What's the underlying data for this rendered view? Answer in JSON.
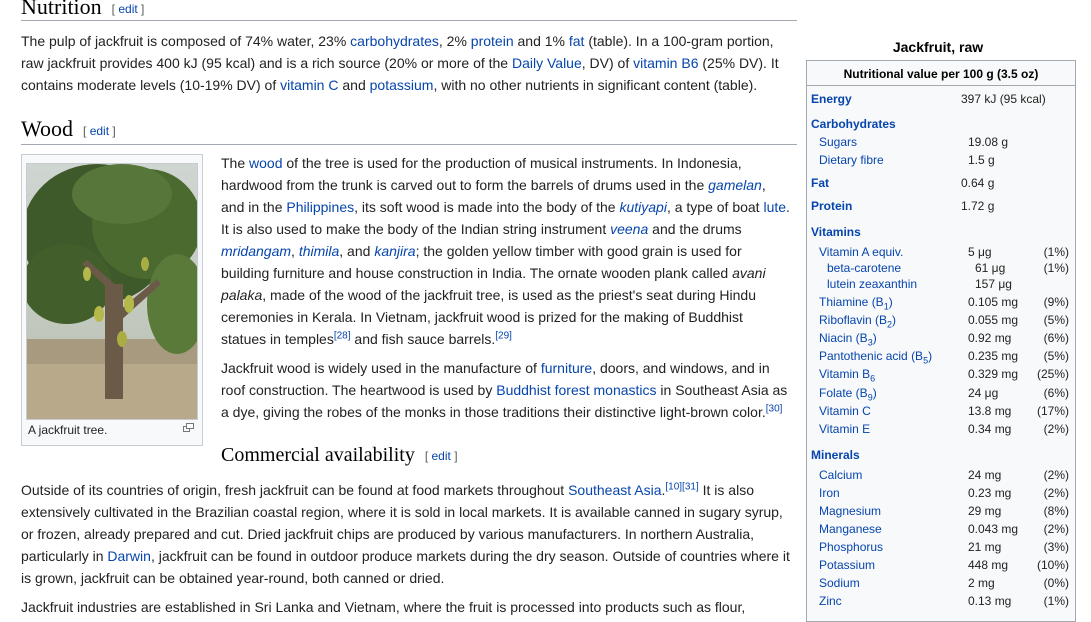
{
  "nutrition": {
    "title": "Nutrition",
    "edit": "edit",
    "text": {
      "p1": "The pulp of jackfruit is composed of 74% water, 23% ",
      "carbohydrates": "carbohydrates",
      "p2": ", 2% ",
      "protein": "protein",
      "p3": " and 1% ",
      "fat": "fat",
      "p4": " (table). In a 100-gram portion,",
      "p5": "raw jackfruit provides 400 kJ (95 kcal) and is a rich source (20% or more of the ",
      "daily_value": "Daily Value",
      "p6": ", DV) of ",
      "vitamin_b6": "vitamin B6",
      "p7": " (25% DV). It",
      "p8": "contains moderate levels (10-19% DV) of ",
      "vitamin_c": "vitamin C",
      "p9": " and ",
      "potassium": "potassium",
      "p10": ", with no other nutrients in significant content (table)."
    }
  },
  "wood": {
    "title": "Wood",
    "edit": "edit",
    "caption": "A jackfruit tree.",
    "expand_icon": "enlarge-icon",
    "lines": {
      "l1a": "The ",
      "l1_wood": "wood",
      "l1b": " of the tree is used for the production of musical instruments. In Indonesia,",
      "l2a": "hardwood from the trunk is carved out to form the barrels of drums used in the ",
      "l2_gamelan": "gamelan",
      "l2b": ",",
      "l3a": "and in the ",
      "l3_phil": "Philippines",
      "l3b": ", its soft wood is made into the body of the ",
      "l3_kutiyapi": "kutiyapi",
      "l3c": ", a type of boat ",
      "l3_lute": "lute",
      "l3d": ".",
      "l4a": "It is also used to make the body of the Indian string instrument ",
      "l4_veena": "veena",
      "l4b": " and the drums",
      "l5_mridangam": "mridangam",
      "l5a": ", ",
      "l5_thimila": "thimila",
      "l5b": ", and ",
      "l5_kanjira": "kanjira",
      "l5c": "; the golden yellow timber with good grain is used for",
      "l6": "building furniture and house construction in India. The ornate wooden plank called ",
      "l6_avani": "avani",
      "l7_palaka": "palaka",
      "l7": ", made of the wood of the jackfruit tree, is used as the priest's seat during Hindu",
      "l8": "ceremonies in Kerala. In Vietnam, jackfruit wood is prized for the making of Buddhist",
      "l9a": "statues in temples",
      "l9_ref1": "[28]",
      "l9b": " and fish sauce barrels.",
      "l9_ref2": "[29]",
      "m1a": "Jackfruit wood is widely used in the manufacture of ",
      "m1_furn": "furniture",
      "m1b": ", doors, and windows, and in",
      "m2a": "roof construction. The heartwood is used by ",
      "m2_bfm": "Buddhist forest monastics",
      "m2b": " in Southeast Asia as",
      "m3": "a dye, giving the robes of the monks in those traditions their distinctive light-brown color.",
      "m3_ref": "[30]"
    }
  },
  "commercial": {
    "title": "Commercial availability",
    "edit": "edit",
    "lines": {
      "c1a": "Outside of its countries of origin, fresh jackfruit can be found at food markets throughout ",
      "c1_sea": "Southeast Asia",
      "c1_ref": "[10][31]",
      "c1b": " It is also",
      "c2": "extensively cultivated in the Brazilian coastal region, where it is sold in local markets. It is available canned in sugary syrup,",
      "c3": "or frozen, already prepared and cut. Dried jackfruit chips are produced by various manufacturers. In northern Australia,",
      "c4a": "particularly in ",
      "c4_darwin": "Darwin",
      "c4b": ", jackfruit can be found in outdoor produce markets during the dry season. Outside of countries where it",
      "c5": "is grown, jackfruit can be obtained year-round, both canned or dried.",
      "c6": "Jackfruit industries are established in Sri Lanka and Vietnam, where the fruit is processed into products such as flour,"
    }
  },
  "infobox": {
    "title": "Jackfruit, raw",
    "header": "Nutritional value per 100 g (3.5 oz)",
    "energy": {
      "label": "Energy",
      "value": "397 kJ (95 kcal)"
    },
    "carbohydrates": "Carbohydrates",
    "sugars": {
      "label": "Sugars",
      "value": "19.08 g"
    },
    "fibre": {
      "label": "Dietary fibre",
      "value": "1.5 g"
    },
    "fat": {
      "label": "Fat",
      "value": "0.64 g"
    },
    "protein": {
      "label": "Protein",
      "value": "1.72 g"
    },
    "vitamins": "Vitamins",
    "vitamin_rows": [
      {
        "label": "Vitamin A equiv.",
        "value": "5 μg",
        "pct": "(1%)"
      },
      {
        "label": "beta-carotene",
        "value": "61 μg",
        "pct": "(1%)"
      },
      {
        "label": "lutein zeaxanthin",
        "value": "157 μg",
        "pct": ""
      },
      {
        "label": "Thiamine (B1)",
        "value": "0.105 mg",
        "pct": "(9%)"
      },
      {
        "label": "Riboflavin (B2)",
        "value": "0.055 mg",
        "pct": "(5%)"
      },
      {
        "label": "Niacin (B3)",
        "value": "0.92 mg",
        "pct": "(6%)"
      },
      {
        "label": "Pantothenic acid (B5)",
        "value": "0.235 mg",
        "pct": "(5%)"
      },
      {
        "label": "Vitamin B6",
        "value": "0.329 mg",
        "pct": "(25%)"
      },
      {
        "label": "Folate (B9)",
        "value": "24 μg",
        "pct": "(6%)"
      },
      {
        "label": "Vitamin C",
        "value": "13.8 mg",
        "pct": "(17%)"
      },
      {
        "label": "Vitamin E",
        "value": "0.34 mg",
        "pct": "(2%)"
      }
    ],
    "minerals": "Minerals",
    "mineral_rows": [
      {
        "label": "Calcium",
        "value": "24 mg",
        "pct": "(2%)"
      },
      {
        "label": "Iron",
        "value": "0.23 mg",
        "pct": "(2%)"
      },
      {
        "label": "Magnesium",
        "value": "29 mg",
        "pct": "(8%)"
      },
      {
        "label": "Manganese",
        "value": "0.043 mg",
        "pct": "(2%)"
      },
      {
        "label": "Phosphorus",
        "value": "21 mg",
        "pct": "(3%)"
      },
      {
        "label": "Potassium",
        "value": "448 mg",
        "pct": "(10%)"
      },
      {
        "label": "Sodium",
        "value": "2 mg",
        "pct": "(0%)"
      },
      {
        "label": "Zinc",
        "value": "0.13 mg",
        "pct": "(1%)"
      }
    ]
  }
}
